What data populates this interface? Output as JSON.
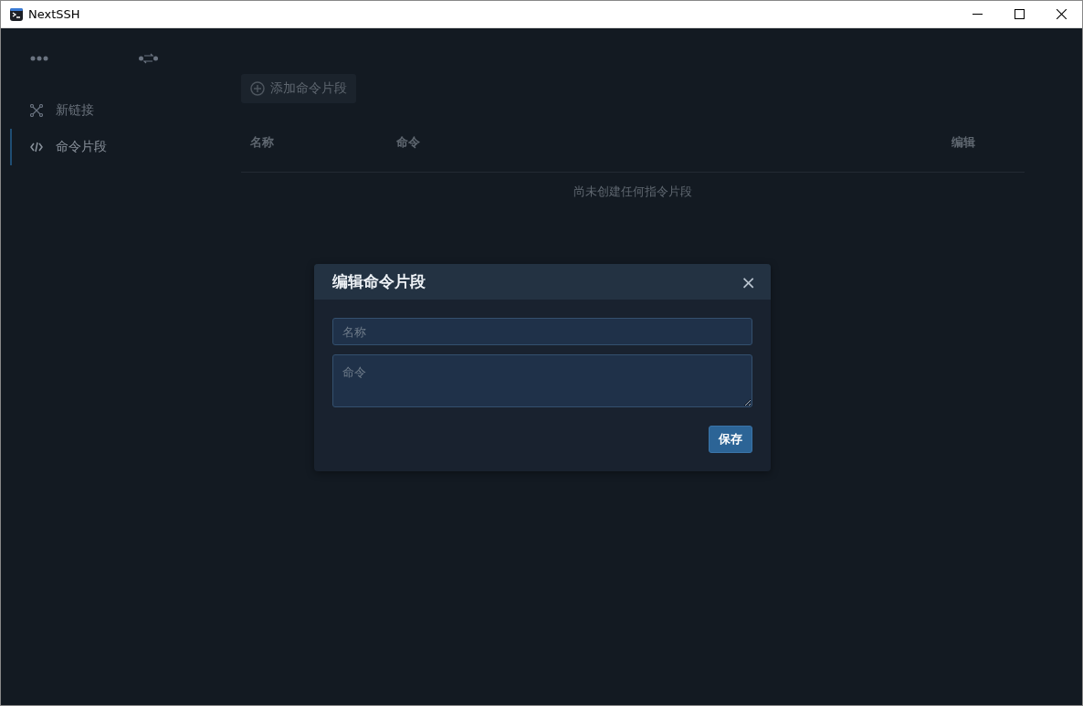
{
  "window": {
    "title": "NextSSH"
  },
  "sidebar": {
    "items": [
      {
        "label": "新链接",
        "kind": "network",
        "selected": false
      },
      {
        "label": "命令片段",
        "kind": "code",
        "selected": true
      }
    ]
  },
  "toolbar": {
    "add_button": "添加命令片段"
  },
  "table": {
    "columns": [
      "名称",
      "命令",
      "编辑"
    ],
    "empty_message": "尚未创建任何指令片段"
  },
  "dialog": {
    "title": "编辑命令片段",
    "close": "×",
    "name_field": {
      "placeholder": "名称"
    },
    "command_field": {
      "placeholder": "命令"
    },
    "save_button": "保存"
  }
}
